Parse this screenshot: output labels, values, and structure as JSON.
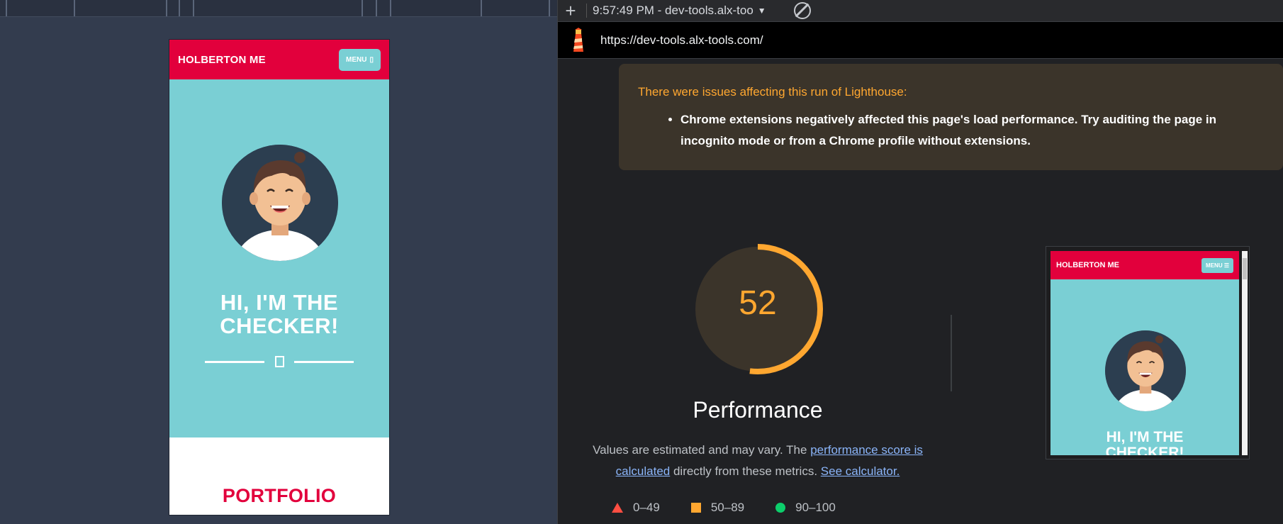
{
  "device_preview": {
    "brand": "HOLBERTON ME",
    "menu_label": "MENU",
    "hero_title_line1": "HI, I'M THE",
    "hero_title_line2": "CHECKER!",
    "portfolio_title": "PORTFOLIO",
    "brand_color": "#e2003c",
    "hero_color": "#7acfd4"
  },
  "toolbar": {
    "add_icon": "plus-icon",
    "report_label": "9:57:49 PM - dev-tools.alx-too",
    "clear_icon": "block-icon"
  },
  "url_bar": {
    "url": "https://dev-tools.alx-tools.com/",
    "logo_icon": "lighthouse-icon"
  },
  "warning": {
    "title": "There were issues affecting this run of Lighthouse:",
    "items": [
      "Chrome extensions negatively affected this page's load performance. Try auditing the page in incognito mode or from a Chrome profile without extensions."
    ]
  },
  "performance": {
    "score": "52",
    "score_fraction": 0.52,
    "label": "Performance",
    "desc_prefix": "Values are estimated and may vary. The ",
    "desc_link1": "performance score is calculated",
    "desc_middle": " directly from these metrics. ",
    "desc_link2": "See calculator.",
    "score_color": "#ffa730"
  },
  "legend": {
    "fail": "0–49",
    "average": "50–89",
    "pass": "90–100"
  },
  "thumbnail": {
    "brand": "HOLBERTON ME",
    "menu_label": "MENU ☰",
    "hero_title_line1": "HI, I'M THE",
    "hero_title_line2": "CHECKER!"
  }
}
